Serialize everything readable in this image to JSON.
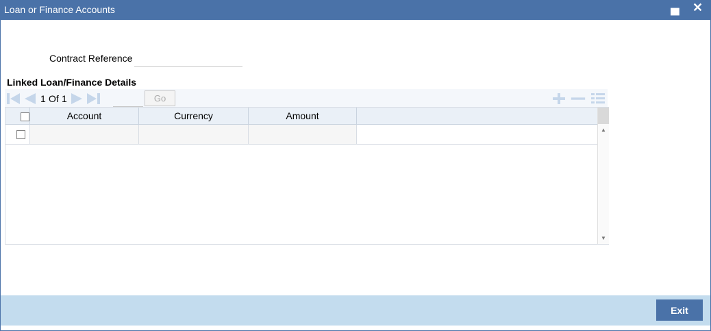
{
  "window": {
    "title": "Loan or Finance Accounts",
    "minimize_icon": "minimize-icon",
    "close_icon": "close-icon"
  },
  "form": {
    "contract_reference_label": "Contract Reference",
    "contract_reference_value": ""
  },
  "linked_section": {
    "title": "Linked Loan/Finance Details",
    "pagination": {
      "current": "1",
      "of_label": "Of",
      "total": "1",
      "go_label": "Go"
    },
    "columns": [
      "Account",
      "Currency",
      "Amount"
    ],
    "rows": [
      {
        "account": "",
        "currency": "",
        "amount": "",
        "checked": false
      }
    ]
  },
  "footer": {
    "exit_label": "Exit"
  },
  "colors": {
    "title_bar": "#4a72a8",
    "footer": "#c3dcee",
    "nav_icon": "#c5d6ea",
    "header_bg": "#eaf0f7"
  }
}
